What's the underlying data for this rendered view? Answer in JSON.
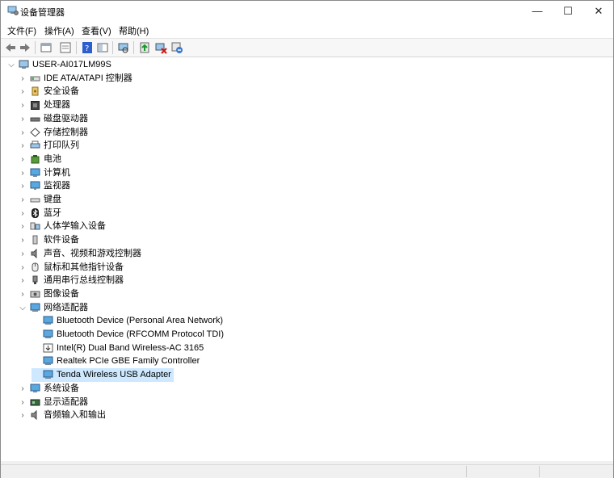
{
  "window": {
    "title": "设备管理器",
    "minimize": "—",
    "maximize": "☐",
    "close": "✕"
  },
  "menu": [
    "文件(F)",
    "操作(A)",
    "查看(V)",
    "帮助(H)"
  ],
  "toolbar": [
    "back-icon",
    "forward-icon",
    "up-icon",
    "properties-icon",
    "help-icon",
    "show-hide-icon",
    "scan-icon",
    "update-driver-icon",
    "disable-icon",
    "uninstall-icon"
  ],
  "tree": {
    "root": "USER-AI017LM99S",
    "categories": [
      {
        "label": "IDE ATA/ATAPI 控制器",
        "icon": "ide-icon"
      },
      {
        "label": "安全设备",
        "icon": "security-icon"
      },
      {
        "label": "处理器",
        "icon": "cpu-icon"
      },
      {
        "label": "磁盘驱动器",
        "icon": "disk-icon"
      },
      {
        "label": "存储控制器",
        "icon": "storage-icon"
      },
      {
        "label": "打印队列",
        "icon": "printer-icon"
      },
      {
        "label": "电池",
        "icon": "battery-icon"
      },
      {
        "label": "计算机",
        "icon": "computer-icon"
      },
      {
        "label": "监视器",
        "icon": "monitor-icon"
      },
      {
        "label": "键盘",
        "icon": "keyboard-icon"
      },
      {
        "label": "蓝牙",
        "icon": "bluetooth-icon"
      },
      {
        "label": "人体学输入设备",
        "icon": "hid-icon"
      },
      {
        "label": "软件设备",
        "icon": "software-icon"
      },
      {
        "label": "声音、视频和游戏控制器",
        "icon": "sound-icon"
      },
      {
        "label": "鼠标和其他指针设备",
        "icon": "mouse-icon"
      },
      {
        "label": "通用串行总线控制器",
        "icon": "usb-icon"
      },
      {
        "label": "图像设备",
        "icon": "camera-icon"
      },
      {
        "label": "网络适配器",
        "icon": "network-icon"
      }
    ],
    "network_children": [
      "Bluetooth Device (Personal Area Network)",
      "Bluetooth Device (RFCOMM Protocol TDI)",
      "Intel(R) Dual Band Wireless-AC 3165",
      "Realtek PCIe GBE Family Controller",
      "Tenda Wireless USB Adapter"
    ],
    "after": [
      {
        "label": "系统设备",
        "icon": "system-icon"
      },
      {
        "label": "显示适配器",
        "icon": "display-adapter-icon"
      },
      {
        "label": "音频输入和输出",
        "icon": "audio-icon"
      }
    ]
  },
  "colors": {
    "selection": "#cde8ff",
    "accent": "#1e88d2"
  }
}
